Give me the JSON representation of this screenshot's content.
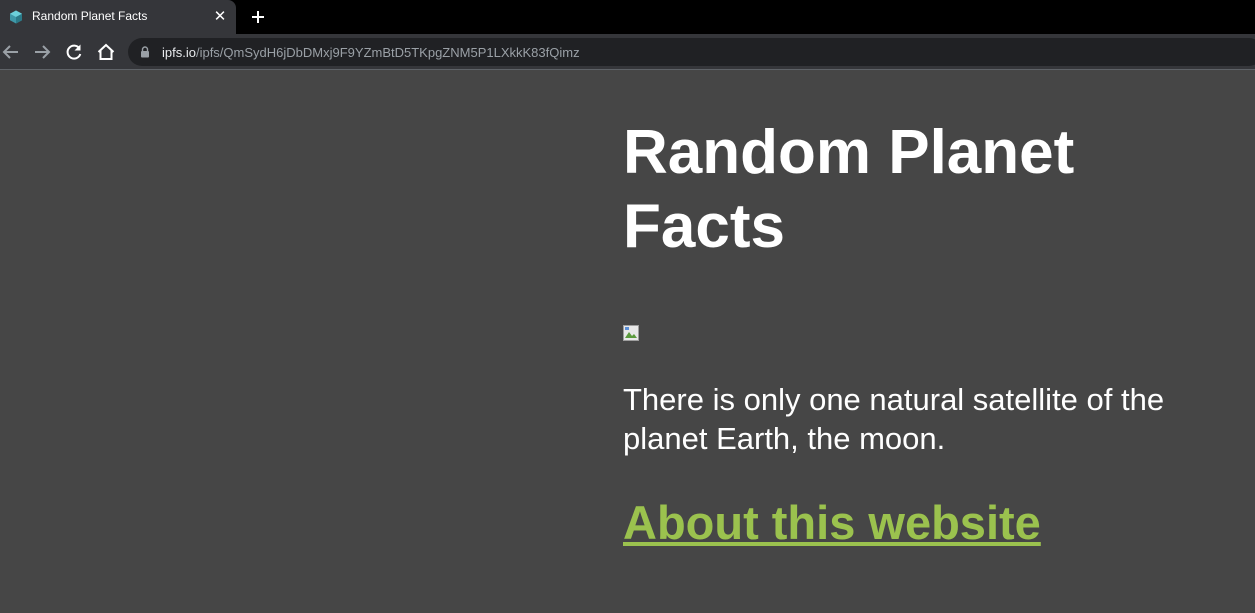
{
  "browser": {
    "tab": {
      "title": "Random Planet Facts",
      "favicon": "ipfs-cube-icon"
    },
    "address_bar": {
      "host": "ipfs.io",
      "path": "/ipfs/QmSydH6jDbDMxj9F9YZmBtD5TKpgZNM5P1LXkkK83fQimz"
    },
    "icons": {
      "back": "arrow-left-icon",
      "forward": "arrow-right-icon",
      "reload": "reload-icon",
      "home": "home-icon",
      "lock": "lock-icon",
      "close": "close-icon",
      "new_tab": "plus-icon"
    },
    "close_glyph": "✕"
  },
  "page": {
    "title": "Random Planet Facts",
    "fact": "There is only one natural satellite of the planet Earth, the moon.",
    "about_link": "About this website"
  },
  "colors": {
    "page_background": "#464646",
    "heading_text": "#ffffff",
    "link": "#9bc24e",
    "tabstrip": "#000000",
    "toolbar": "#35363a",
    "omnibox": "#202124"
  }
}
